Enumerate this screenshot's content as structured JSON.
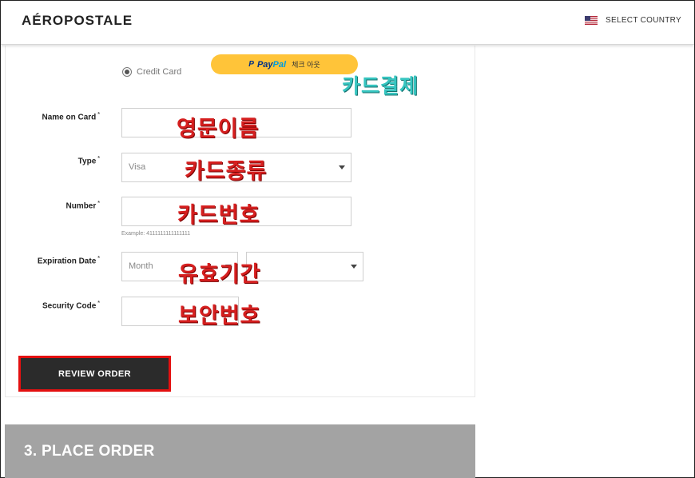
{
  "header": {
    "logo": "AÉROPOSTALE",
    "country_label": "SELECT COUNTRY",
    "flag_icon": "us-flag-icon"
  },
  "payment": {
    "credit_card_label": "Credit Card",
    "paypal": {
      "mark": "P",
      "brand_part1": "Pay",
      "brand_part2": "Pal",
      "checkout_label": "체크 아웃"
    }
  },
  "form": {
    "name_label": "Name on Card",
    "type_label": "Type",
    "type_value": "Visa",
    "number_label": "Number",
    "number_hint": "Example: 4111111111111111",
    "expiry_label": "Expiration Date",
    "expiry_month_value": "Month",
    "security_label": "Security Code",
    "required_mark": "*"
  },
  "annotations": {
    "card_payment": "카드결제",
    "english_name": "영문이름",
    "card_type": "카드종류",
    "card_number": "카드번호",
    "expiry": "유효기간",
    "security_code": "보안번호"
  },
  "buttons": {
    "review_order": "REVIEW ORDER"
  },
  "sections": {
    "place_order": "3. PLACE ORDER"
  },
  "colors": {
    "paypal_yellow": "#ffc439",
    "highlight_red": "#e41010",
    "annotation_red": "#d61f1f",
    "annotation_teal": "#36c5c0",
    "button_dark": "#2b2b2b",
    "section_gray": "#a3a3a3"
  }
}
